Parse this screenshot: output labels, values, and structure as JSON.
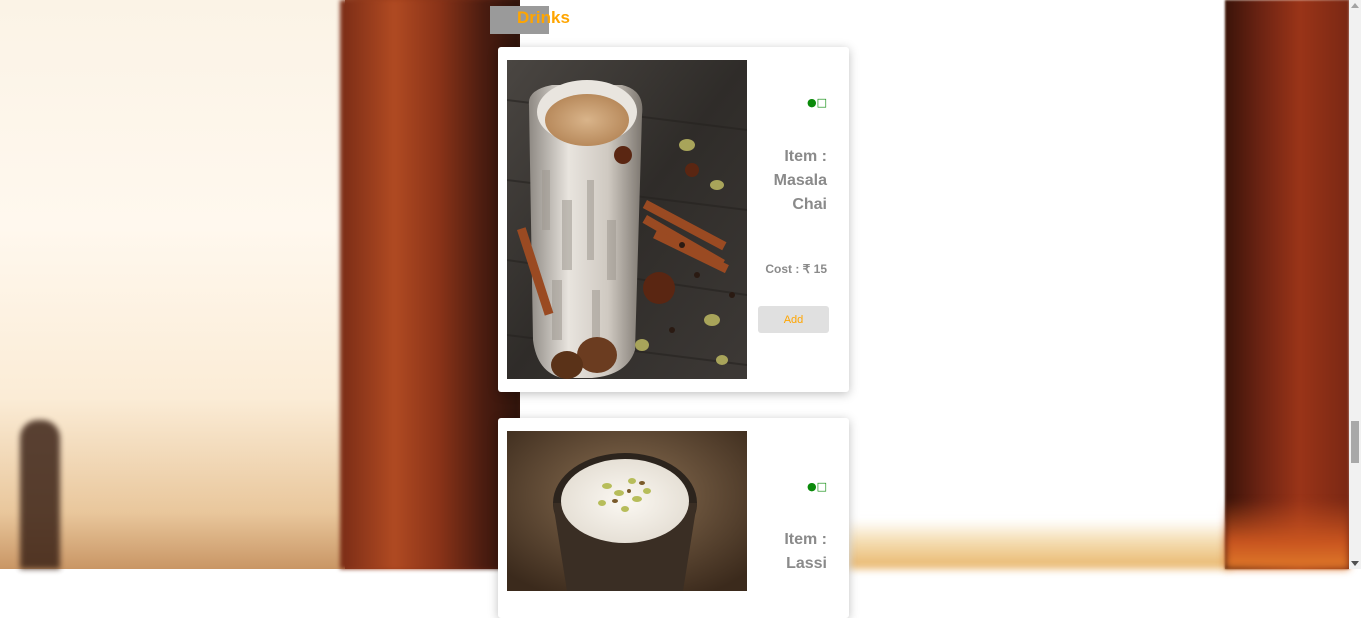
{
  "section": {
    "title": "Drinks"
  },
  "items": [
    {
      "veg_symbol": "●□",
      "name_label": "Item :",
      "name_line1": "Masala",
      "name_line2": "Chai",
      "cost_text": "Cost : ₹ 15",
      "add_label": "Add",
      "image_alt": "masala-chai-photo"
    },
    {
      "veg_symbol": "●□",
      "name_label": "Item :",
      "name_line1": "Lassi",
      "image_alt": "lassi-photo"
    }
  ],
  "colors": {
    "accent": "#ffa500",
    "veg_green": "#0a8a0a",
    "text_gray": "#8a8a8a",
    "button_bg": "#e0e0e0"
  }
}
